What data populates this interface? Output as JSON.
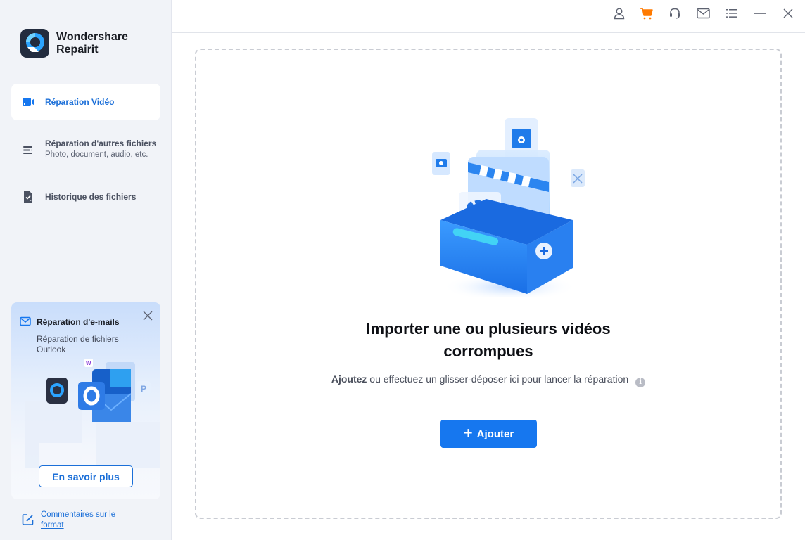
{
  "app": {
    "brand_line1": "Wondershare",
    "brand_line2": "Repairit"
  },
  "sidebar": {
    "items": [
      {
        "id": "video-repair",
        "label": "Réparation Vidéo",
        "active": true,
        "icon": "video-camera-icon"
      },
      {
        "id": "other-files",
        "label": "Réparation d'autres fichiers",
        "sublabel": "Photo, document, audio, etc.",
        "active": false,
        "icon": "list-icon"
      },
      {
        "id": "history",
        "label": "Historique des fichiers",
        "active": false,
        "icon": "file-check-icon"
      }
    ],
    "promo": {
      "title": "Réparation d'e-mails",
      "subtitle": "Réparation de fichiers Outlook",
      "button_label": "En savoir plus",
      "close_icon": "close-icon"
    },
    "feedback_link": "Commentaires sur le format"
  },
  "topbar": {
    "icons": [
      "user-icon",
      "cart-icon",
      "headset-icon",
      "mail-icon",
      "menu-icon",
      "minimize-icon",
      "close-icon"
    ]
  },
  "main": {
    "title": "Importer une ou plusieurs vidéos corrompues",
    "hint_bold": "Ajoutez",
    "hint_rest": " ou effectuez un glisser-déposer ici pour lancer la réparation",
    "info_glyph": "i",
    "add_button_plus": "+",
    "add_button_label": "Ajouter"
  },
  "colors": {
    "accent": "#1677ef",
    "link": "#1b6fd8",
    "cart": "#ff7a00",
    "sidebar_bg": "#f1f3f8"
  }
}
